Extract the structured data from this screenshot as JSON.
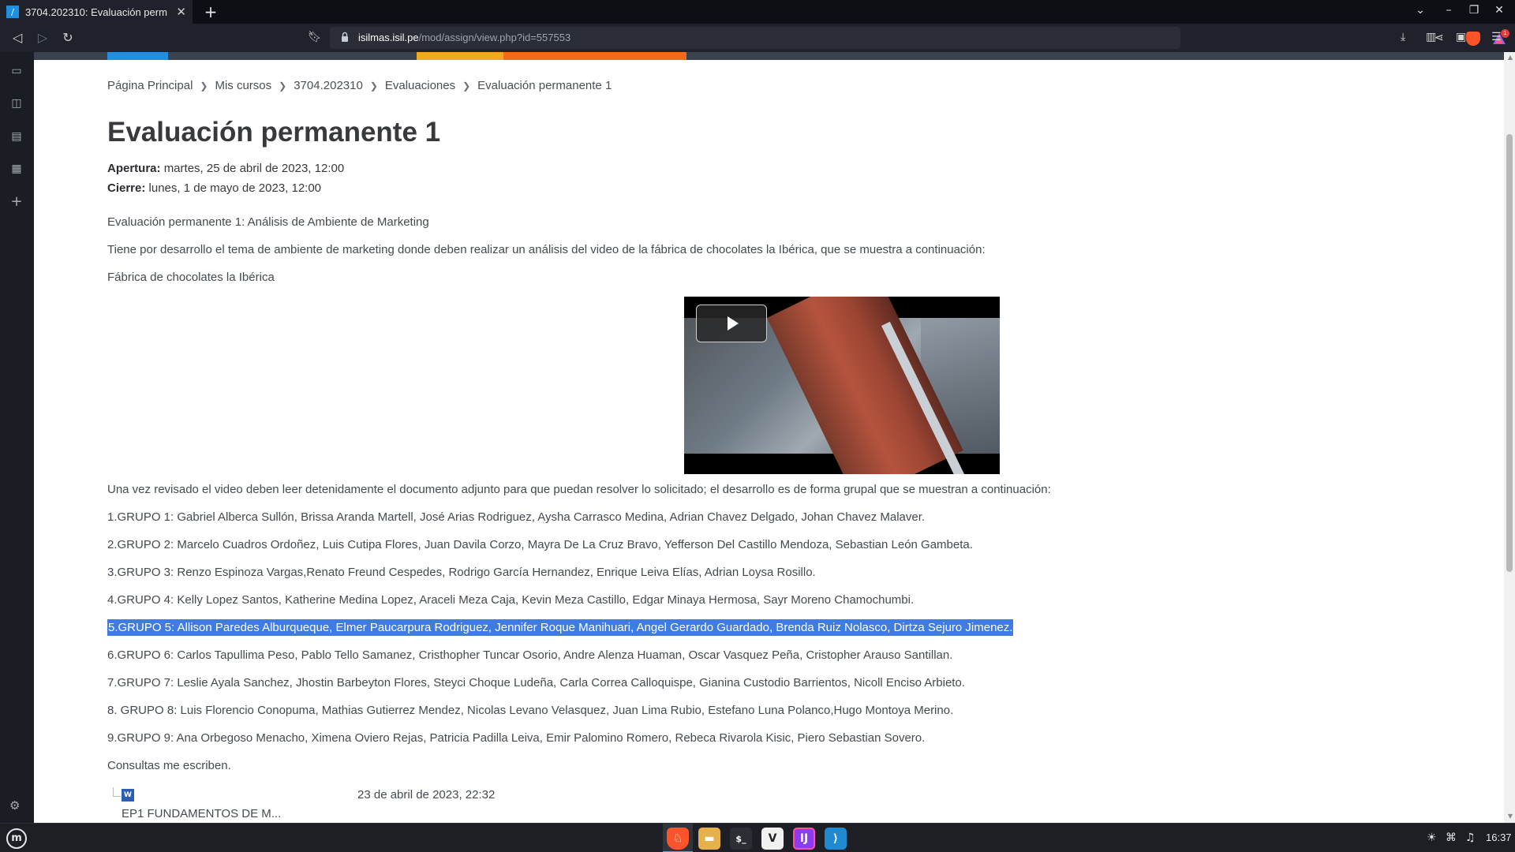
{
  "browser": {
    "tab_title": "3704.202310: Evaluación perm",
    "url_host": "isilmas.isil.pe",
    "url_path": "/mod/assign/view.php?id=557553",
    "shield_badge": "0",
    "notif_badge": "1"
  },
  "breadcrumb": [
    "Página Principal",
    "Mis cursos",
    "3704.202310",
    "Evaluaciones",
    "Evaluación permanente 1"
  ],
  "page_title": "Evaluación permanente 1",
  "dates": {
    "opening_label": "Apertura:",
    "opening_value": "martes, 25 de abril de 2023, 12:00",
    "closing_label": "Cierre:",
    "closing_value": "lunes, 1 de mayo de 2023, 12:00"
  },
  "intro": [
    "Evaluación permanente 1: Análisis de Ambiente de Marketing",
    "Tiene por desarrollo el tema de ambiente de marketing donde deben realizar un análisis del video de la fábrica de chocolates la Ibérica, que se muestra a continuación:",
    "Fábrica de chocolates la Ibérica"
  ],
  "after_video": "Una vez revisado el video deben leer detenidamente el documento adjunto para que puedan resolver lo solicitado; el desarrollo es de forma grupal que se muestran a continuación:",
  "groups": [
    "1.GRUPO 1: Gabriel Alberca Sullón, Brissa Aranda Martell, José Arias Rodriguez, Aysha Carrasco Medina, Adrian Chavez Delgado, Johan Chavez Malaver.",
    "2.GRUPO 2: Marcelo Cuadros Ordoñez, Luis Cutipa Flores, Juan Davila Corzo, Mayra De La Cruz Bravo, Yefferson Del Castillo Mendoza, Sebastian León Gambeta.",
    "3.GRUPO 3: Renzo Espinoza Vargas,Renato Freund Cespedes, Rodrigo García Hernandez, Enrique Leiva Elías, Adrian Loysa Rosillo.",
    "4.GRUPO 4: Kelly Lopez Santos, Katherine Medina Lopez, Araceli Meza Caja, Kevin Meza Castillo, Edgar Minaya Hermosa, Sayr Moreno Chamochumbi.",
    "5.GRUPO 5: Allison Paredes Alburqueque,  Elmer Paucarpura Rodriguez, Jennifer Roque Manihuari, Angel Gerardo Guardado, Brenda Ruiz Nolasco, Dirtza Sejuro Jimenez.",
    "6.GRUPO 6: Carlos Tapullima Peso, Pablo Tello Samanez, Cristhopher Tuncar Osorio, Andre Alenza Huaman, Oscar Vasquez Peña, Cristopher Arauso Santillan.",
    "7.GRUPO 7: Leslie Ayala Sanchez, Jhostin Barbeyton Flores, Steyci Choque Ludeña, Carla Correa Calloquispe, Gianina Custodio Barrientos, Nicoll Enciso Arbieto.",
    "8. GRUPO 8: Luis Florencio Conopuma, Mathias Gutierrez Mendez, Nicolas Levano Velasquez, Juan Lima Rubio, Estefano Luna Polanco,Hugo Montoya Merino.",
    "9.GRUPO 9: Ana Orbegoso Menacho, Ximena Oviero Rejas, Patricia Padilla Leiva, Emir Palomino Romero, Rebeca Rivarola Kisic, Piero Sebastian Sovero."
  ],
  "closing_note": "Consultas me escriben.",
  "attachment": {
    "icon": "W",
    "date": "23 de abril de 2023, 22:32",
    "name": "EP1 FUNDAMENTOS DE M..."
  },
  "taskbar": {
    "clock": "16:37"
  },
  "colors": {
    "selection": "#3f7be0",
    "strip_blue": "#1e8fe1",
    "strip_yellow": "#f5a623",
    "strip_orange": "#f26b1d"
  }
}
